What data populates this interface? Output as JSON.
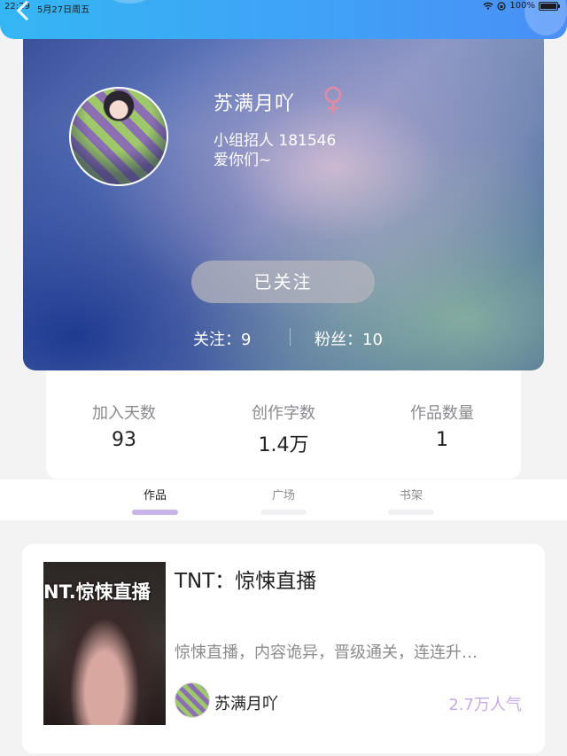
{
  "status_bar": {
    "time": "22:29",
    "date": "5月27日周五",
    "battery": "100%"
  },
  "profile": {
    "username": "苏满月吖",
    "gender": "female",
    "bio_line_1": "小组招人 181546",
    "bio_line_2": "爱你们~",
    "follow_button": "已关注",
    "following": "关注：9",
    "fans": "粉丝：10"
  },
  "stats": [
    {
      "label": "加入天数",
      "value": "93"
    },
    {
      "label": "创作字数",
      "value": "1.4万"
    },
    {
      "label": "作品数量",
      "value": "1"
    }
  ],
  "tabs": [
    {
      "label": "作品",
      "active": true
    },
    {
      "label": "广场",
      "active": false
    },
    {
      "label": "书架",
      "active": false
    }
  ],
  "work": {
    "cover_text": "NT.惊悚直播",
    "title": "TNT：惊悚直播",
    "description": "惊悚直播，内容诡异，晋级通关，连连升…",
    "author": "苏满月吖",
    "popularity": "2.7万人气"
  },
  "colors": {
    "header_blue": "#35b6f4",
    "tab_indicator_active": "#c9b4ea",
    "popularity_text": "#c6ace6",
    "gender_icon": "#e58aa3"
  }
}
